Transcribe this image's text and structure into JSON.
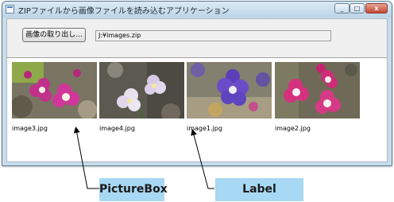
{
  "window": {
    "title": "ZIPファイルから画像ファイルを読み込むアプリケーション"
  },
  "toolbar": {
    "extract_button_label": "画像の取り出し...",
    "zip_path": "J:¥images.zip"
  },
  "images": [
    {
      "caption": "image3.jpg",
      "icon": "pink-flower-photo"
    },
    {
      "caption": "image4.jpg",
      "icon": "white-flower-photo"
    },
    {
      "caption": "image1.jpg",
      "icon": "purple-flower-photo"
    },
    {
      "caption": "image2.jpg",
      "icon": "pink-flower-photo"
    }
  ],
  "callouts": {
    "picturebox": "PictureBox",
    "label": "Label"
  },
  "colors": {
    "titlebar": "#c9dceb",
    "callout_fill": "#a7d8f4",
    "close_button": "#c3482f"
  }
}
